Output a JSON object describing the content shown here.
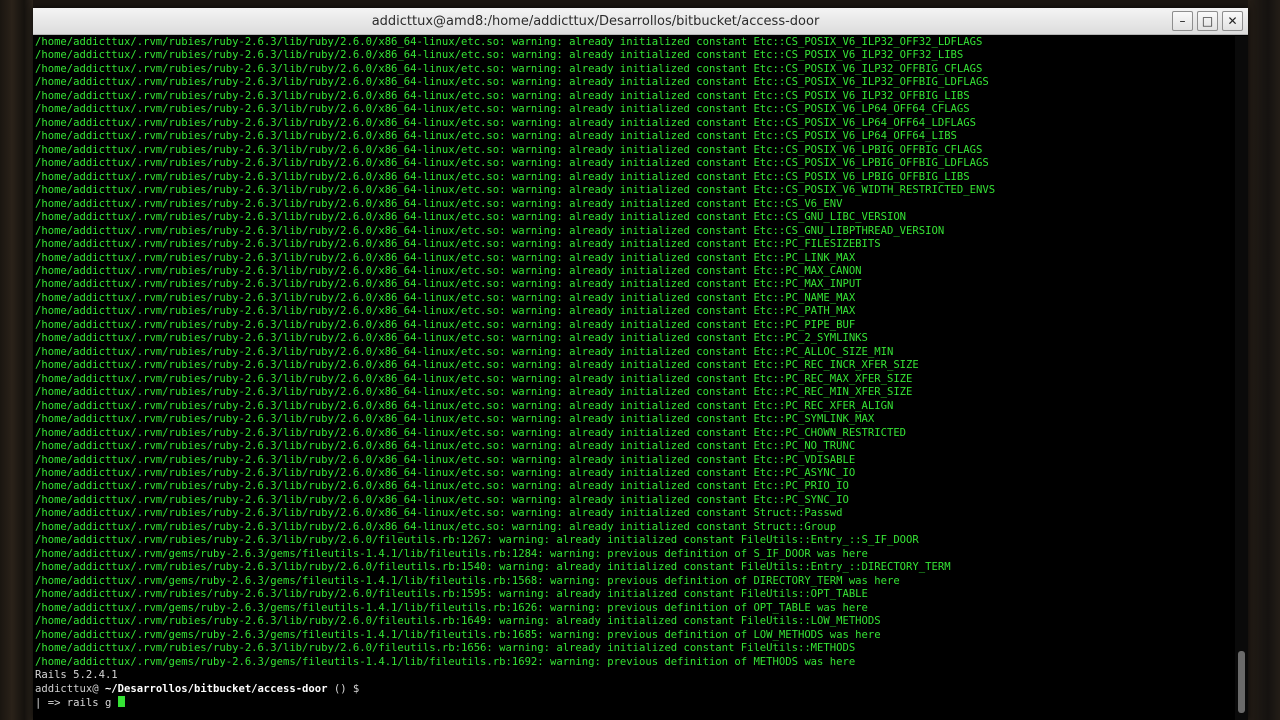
{
  "window": {
    "title": "addicttux@amd8:/home/addicttux/Desarrollos/bitbucket/access-door",
    "buttons": {
      "minimize": "–",
      "maximize": "□",
      "close": "✕"
    }
  },
  "terminal": {
    "lines": [
      "/home/addicttux/.rvm/rubies/ruby-2.6.3/lib/ruby/2.6.0/x86_64-linux/etc.so: warning: already initialized constant Etc::CS_POSIX_V6_ILP32_OFF32_LDFLAGS",
      "/home/addicttux/.rvm/rubies/ruby-2.6.3/lib/ruby/2.6.0/x86_64-linux/etc.so: warning: already initialized constant Etc::CS_POSIX_V6_ILP32_OFF32_LIBS",
      "/home/addicttux/.rvm/rubies/ruby-2.6.3/lib/ruby/2.6.0/x86_64-linux/etc.so: warning: already initialized constant Etc::CS_POSIX_V6_ILP32_OFFBIG_CFLAGS",
      "/home/addicttux/.rvm/rubies/ruby-2.6.3/lib/ruby/2.6.0/x86_64-linux/etc.so: warning: already initialized constant Etc::CS_POSIX_V6_ILP32_OFFBIG_LDFLAGS",
      "/home/addicttux/.rvm/rubies/ruby-2.6.3/lib/ruby/2.6.0/x86_64-linux/etc.so: warning: already initialized constant Etc::CS_POSIX_V6_ILP32_OFFBIG_LIBS",
      "/home/addicttux/.rvm/rubies/ruby-2.6.3/lib/ruby/2.6.0/x86_64-linux/etc.so: warning: already initialized constant Etc::CS_POSIX_V6_LP64_OFF64_CFLAGS",
      "/home/addicttux/.rvm/rubies/ruby-2.6.3/lib/ruby/2.6.0/x86_64-linux/etc.so: warning: already initialized constant Etc::CS_POSIX_V6_LP64_OFF64_LDFLAGS",
      "/home/addicttux/.rvm/rubies/ruby-2.6.3/lib/ruby/2.6.0/x86_64-linux/etc.so: warning: already initialized constant Etc::CS_POSIX_V6_LP64_OFF64_LIBS",
      "/home/addicttux/.rvm/rubies/ruby-2.6.3/lib/ruby/2.6.0/x86_64-linux/etc.so: warning: already initialized constant Etc::CS_POSIX_V6_LPBIG_OFFBIG_CFLAGS",
      "/home/addicttux/.rvm/rubies/ruby-2.6.3/lib/ruby/2.6.0/x86_64-linux/etc.so: warning: already initialized constant Etc::CS_POSIX_V6_LPBIG_OFFBIG_LDFLAGS",
      "/home/addicttux/.rvm/rubies/ruby-2.6.3/lib/ruby/2.6.0/x86_64-linux/etc.so: warning: already initialized constant Etc::CS_POSIX_V6_LPBIG_OFFBIG_LIBS",
      "/home/addicttux/.rvm/rubies/ruby-2.6.3/lib/ruby/2.6.0/x86_64-linux/etc.so: warning: already initialized constant Etc::CS_POSIX_V6_WIDTH_RESTRICTED_ENVS",
      "/home/addicttux/.rvm/rubies/ruby-2.6.3/lib/ruby/2.6.0/x86_64-linux/etc.so: warning: already initialized constant Etc::CS_V6_ENV",
      "/home/addicttux/.rvm/rubies/ruby-2.6.3/lib/ruby/2.6.0/x86_64-linux/etc.so: warning: already initialized constant Etc::CS_GNU_LIBC_VERSION",
      "/home/addicttux/.rvm/rubies/ruby-2.6.3/lib/ruby/2.6.0/x86_64-linux/etc.so: warning: already initialized constant Etc::CS_GNU_LIBPTHREAD_VERSION",
      "/home/addicttux/.rvm/rubies/ruby-2.6.3/lib/ruby/2.6.0/x86_64-linux/etc.so: warning: already initialized constant Etc::PC_FILESIZEBITS",
      "/home/addicttux/.rvm/rubies/ruby-2.6.3/lib/ruby/2.6.0/x86_64-linux/etc.so: warning: already initialized constant Etc::PC_LINK_MAX",
      "/home/addicttux/.rvm/rubies/ruby-2.6.3/lib/ruby/2.6.0/x86_64-linux/etc.so: warning: already initialized constant Etc::PC_MAX_CANON",
      "/home/addicttux/.rvm/rubies/ruby-2.6.3/lib/ruby/2.6.0/x86_64-linux/etc.so: warning: already initialized constant Etc::PC_MAX_INPUT",
      "/home/addicttux/.rvm/rubies/ruby-2.6.3/lib/ruby/2.6.0/x86_64-linux/etc.so: warning: already initialized constant Etc::PC_NAME_MAX",
      "/home/addicttux/.rvm/rubies/ruby-2.6.3/lib/ruby/2.6.0/x86_64-linux/etc.so: warning: already initialized constant Etc::PC_PATH_MAX",
      "/home/addicttux/.rvm/rubies/ruby-2.6.3/lib/ruby/2.6.0/x86_64-linux/etc.so: warning: already initialized constant Etc::PC_PIPE_BUF",
      "/home/addicttux/.rvm/rubies/ruby-2.6.3/lib/ruby/2.6.0/x86_64-linux/etc.so: warning: already initialized constant Etc::PC_2_SYMLINKS",
      "/home/addicttux/.rvm/rubies/ruby-2.6.3/lib/ruby/2.6.0/x86_64-linux/etc.so: warning: already initialized constant Etc::PC_ALLOC_SIZE_MIN",
      "/home/addicttux/.rvm/rubies/ruby-2.6.3/lib/ruby/2.6.0/x86_64-linux/etc.so: warning: already initialized constant Etc::PC_REC_INCR_XFER_SIZE",
      "/home/addicttux/.rvm/rubies/ruby-2.6.3/lib/ruby/2.6.0/x86_64-linux/etc.so: warning: already initialized constant Etc::PC_REC_MAX_XFER_SIZE",
      "/home/addicttux/.rvm/rubies/ruby-2.6.3/lib/ruby/2.6.0/x86_64-linux/etc.so: warning: already initialized constant Etc::PC_REC_MIN_XFER_SIZE",
      "/home/addicttux/.rvm/rubies/ruby-2.6.3/lib/ruby/2.6.0/x86_64-linux/etc.so: warning: already initialized constant Etc::PC_REC_XFER_ALIGN",
      "/home/addicttux/.rvm/rubies/ruby-2.6.3/lib/ruby/2.6.0/x86_64-linux/etc.so: warning: already initialized constant Etc::PC_SYMLINK_MAX",
      "/home/addicttux/.rvm/rubies/ruby-2.6.3/lib/ruby/2.6.0/x86_64-linux/etc.so: warning: already initialized constant Etc::PC_CHOWN_RESTRICTED",
      "/home/addicttux/.rvm/rubies/ruby-2.6.3/lib/ruby/2.6.0/x86_64-linux/etc.so: warning: already initialized constant Etc::PC_NO_TRUNC",
      "/home/addicttux/.rvm/rubies/ruby-2.6.3/lib/ruby/2.6.0/x86_64-linux/etc.so: warning: already initialized constant Etc::PC_VDISABLE",
      "/home/addicttux/.rvm/rubies/ruby-2.6.3/lib/ruby/2.6.0/x86_64-linux/etc.so: warning: already initialized constant Etc::PC_ASYNC_IO",
      "/home/addicttux/.rvm/rubies/ruby-2.6.3/lib/ruby/2.6.0/x86_64-linux/etc.so: warning: already initialized constant Etc::PC_PRIO_IO",
      "/home/addicttux/.rvm/rubies/ruby-2.6.3/lib/ruby/2.6.0/x86_64-linux/etc.so: warning: already initialized constant Etc::PC_SYNC_IO",
      "/home/addicttux/.rvm/rubies/ruby-2.6.3/lib/ruby/2.6.0/x86_64-linux/etc.so: warning: already initialized constant Struct::Passwd",
      "/home/addicttux/.rvm/rubies/ruby-2.6.3/lib/ruby/2.6.0/x86_64-linux/etc.so: warning: already initialized constant Struct::Group",
      "/home/addicttux/.rvm/rubies/ruby-2.6.3/lib/ruby/2.6.0/fileutils.rb:1267: warning: already initialized constant FileUtils::Entry_::S_IF_DOOR",
      "/home/addicttux/.rvm/gems/ruby-2.6.3/gems/fileutils-1.4.1/lib/fileutils.rb:1284: warning: previous definition of S_IF_DOOR was here",
      "/home/addicttux/.rvm/rubies/ruby-2.6.3/lib/ruby/2.6.0/fileutils.rb:1540: warning: already initialized constant FileUtils::Entry_::DIRECTORY_TERM",
      "/home/addicttux/.rvm/gems/ruby-2.6.3/gems/fileutils-1.4.1/lib/fileutils.rb:1568: warning: previous definition of DIRECTORY_TERM was here",
      "/home/addicttux/.rvm/rubies/ruby-2.6.3/lib/ruby/2.6.0/fileutils.rb:1595: warning: already initialized constant FileUtils::OPT_TABLE",
      "/home/addicttux/.rvm/gems/ruby-2.6.3/gems/fileutils-1.4.1/lib/fileutils.rb:1626: warning: previous definition of OPT_TABLE was here",
      "/home/addicttux/.rvm/rubies/ruby-2.6.3/lib/ruby/2.6.0/fileutils.rb:1649: warning: already initialized constant FileUtils::LOW_METHODS",
      "/home/addicttux/.rvm/gems/ruby-2.6.3/gems/fileutils-1.4.1/lib/fileutils.rb:1685: warning: previous definition of LOW_METHODS was here",
      "/home/addicttux/.rvm/rubies/ruby-2.6.3/lib/ruby/2.6.0/fileutils.rb:1656: warning: already initialized constant FileUtils::METHODS",
      "/home/addicttux/.rvm/gems/ruby-2.6.3/gems/fileutils-1.4.1/lib/fileutils.rb:1692: warning: previous definition of METHODS was here"
    ],
    "version_line": "Rails 5.2.4.1",
    "prompt": {
      "user": "addicttux@",
      "path": " ~/Desarrollos/bitbucket/access-door",
      "suffix": " () $"
    },
    "input_prefix": "| => ",
    "input_value": "rails g"
  }
}
